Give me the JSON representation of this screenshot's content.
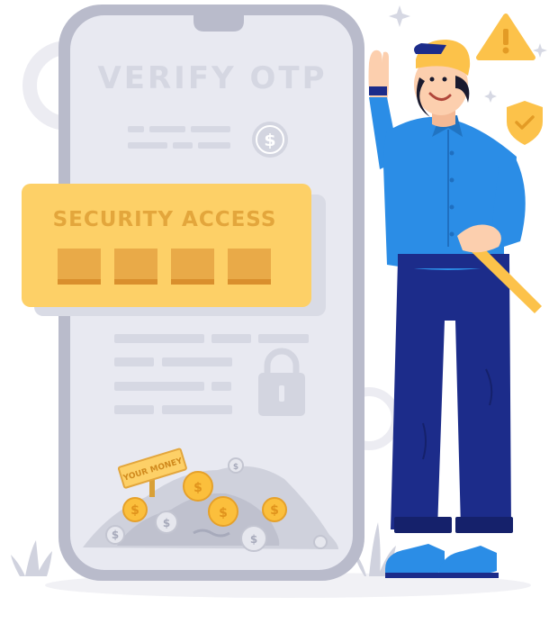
{
  "phone": {
    "title": "VERIFY OTP"
  },
  "security_panel": {
    "heading": "SECURITY ACCESS",
    "otp_boxes": 4
  },
  "treasure": {
    "sign_text": "YOUR MONEY",
    "coin_symbol": "$"
  },
  "colors": {
    "phone_body": "#e8e9f1",
    "phone_frame": "#b9bbcb",
    "placeholder": "#d6d8e3",
    "panel": "#fdd067",
    "panel_text": "#e3a63c",
    "otp_box": "#e9aa48",
    "coin": "#fbbf3c",
    "shirt": "#2b8de6",
    "pants": "#1c2c8a",
    "cap": "#f9c13f",
    "warning": "#fcc24a",
    "shield": "#fcc24a"
  },
  "icons": [
    "dollar-coin-icon",
    "lock-icon",
    "warning-icon",
    "shield-check-icon",
    "sparkle-icon"
  ]
}
